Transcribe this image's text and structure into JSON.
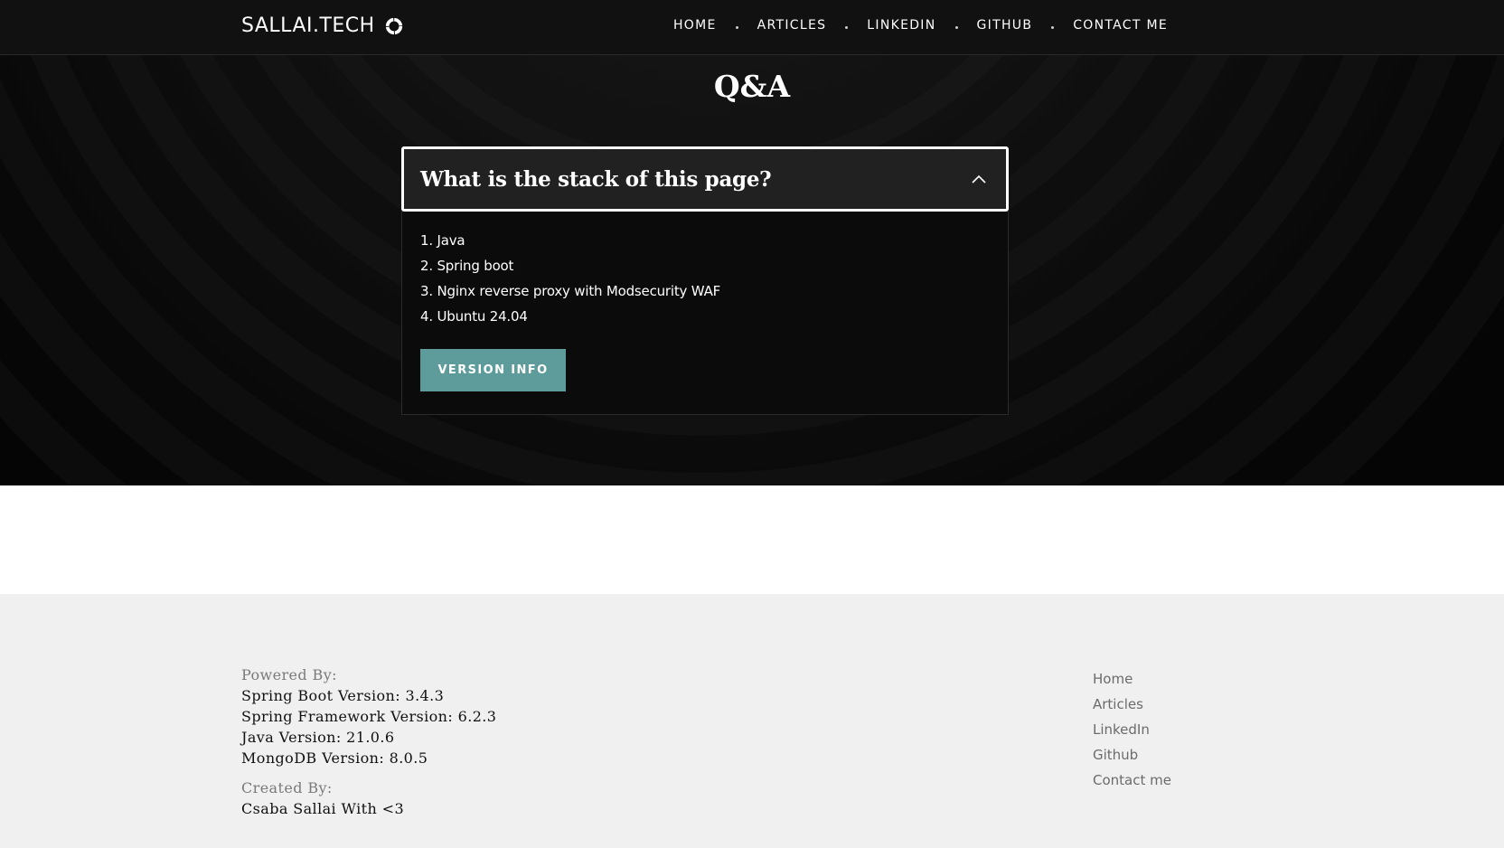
{
  "navbar": {
    "brand": "SALLAI.TECH",
    "brand_icon": "ring-logo-icon",
    "links": [
      {
        "label": "HOME"
      },
      {
        "label": "ARTICLES"
      },
      {
        "label": "LINKEDIN"
      },
      {
        "label": "GITHUB"
      },
      {
        "label": "CONTACT ME"
      }
    ]
  },
  "hero": {
    "title": "Q&A"
  },
  "accordion": {
    "question": "What is the stack of this page?",
    "expanded": true,
    "toggle_icon": "chevron-up-icon",
    "items": [
      "1. Java",
      "2. Spring boot",
      "3. Nginx reverse proxy with Modsecurity WAF",
      "4. Ubuntu 24.04"
    ],
    "button_label": "VERSION INFO"
  },
  "footer": {
    "powered_by_heading": "Powered By:",
    "powered_by": [
      "Spring Boot Version: 3.4.3",
      "Spring Framework Version: 6.2.3",
      "Java Version: 21.0.6",
      "MongoDB Version: 8.0.5"
    ],
    "created_by_heading": "Created By:",
    "created_by": "Csaba Sallai With <3",
    "links": [
      "Home",
      "Articles",
      "LinkedIn",
      "Github",
      "Contact me"
    ]
  },
  "colors": {
    "navbar_bg": "#111111",
    "hero_bg": "#050505",
    "accordion_header_bg": "#212121",
    "button_accent": "#5e9c9c",
    "footer_bg": "#f0f0f0"
  }
}
